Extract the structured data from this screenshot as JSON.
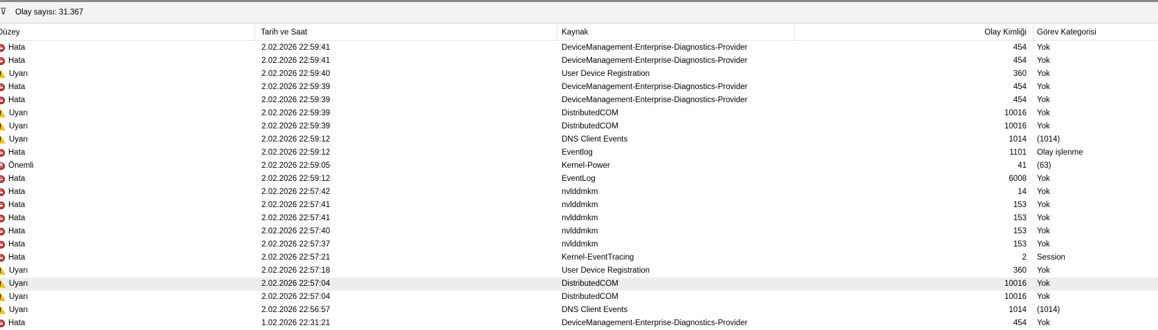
{
  "toolbar": {
    "filter_glyph": "⊽",
    "event_count": "Olay sayısı: 31.367"
  },
  "columns": {
    "level": "Düzey",
    "date": "Tarih ve Saat",
    "source": "Kaynak",
    "event_id": "Olay Kimliği",
    "task_category": "Görev Kategorisi"
  },
  "icons": {
    "error": "error-icon",
    "warning": "warning-icon",
    "critical": "critical-icon"
  },
  "colors": {
    "selected_row": "#ededed",
    "error_red": "#c01515",
    "warning_yellow": "#f3c400"
  },
  "rows": [
    {
      "level": "Hata",
      "icon": "error",
      "date": "2.02.2026 22:59:41",
      "source": "DeviceManagement-Enterprise-Diagnostics-Provider",
      "id": "454",
      "category": "Yok"
    },
    {
      "level": "Hata",
      "icon": "error",
      "date": "2.02.2026 22:59:41",
      "source": "DeviceManagement-Enterprise-Diagnostics-Provider",
      "id": "454",
      "category": "Yok"
    },
    {
      "level": "Uyarı",
      "icon": "warning",
      "date": "2.02.2026 22:59:40",
      "source": "User Device Registration",
      "id": "360",
      "category": "Yok"
    },
    {
      "level": "Hata",
      "icon": "error",
      "date": "2.02.2026 22:59:39",
      "source": "DeviceManagement-Enterprise-Diagnostics-Provider",
      "id": "454",
      "category": "Yok"
    },
    {
      "level": "Hata",
      "icon": "error",
      "date": "2.02.2026 22:59:39",
      "source": "DeviceManagement-Enterprise-Diagnostics-Provider",
      "id": "454",
      "category": "Yok"
    },
    {
      "level": "Uyarı",
      "icon": "warning",
      "date": "2.02.2026 22:59:39",
      "source": "DistributedCOM",
      "id": "10016",
      "category": "Yok"
    },
    {
      "level": "Uyarı",
      "icon": "warning",
      "date": "2.02.2026 22:59:39",
      "source": "DistributedCOM",
      "id": "10016",
      "category": "Yok"
    },
    {
      "level": "Uyarı",
      "icon": "warning",
      "date": "2.02.2026 22:59:12",
      "source": "DNS Client Events",
      "id": "1014",
      "category": "(1014)"
    },
    {
      "level": "Hata",
      "icon": "error",
      "date": "2.02.2026 22:59:12",
      "source": "Eventlog",
      "id": "1101",
      "category": "Olay işlenme"
    },
    {
      "level": "Önemli",
      "icon": "critical",
      "date": "2.02.2026 22:59:05",
      "source": "Kernel-Power",
      "id": "41",
      "category": "(63)"
    },
    {
      "level": "Hata",
      "icon": "error",
      "date": "2.02.2026 22:59:12",
      "source": "EventLog",
      "id": "6008",
      "category": "Yok"
    },
    {
      "level": "Hata",
      "icon": "error",
      "date": "2.02.2026 22:57:42",
      "source": "nvlddmkm",
      "id": "14",
      "category": "Yok"
    },
    {
      "level": "Hata",
      "icon": "error",
      "date": "2.02.2026 22:57:41",
      "source": "nvlddmkm",
      "id": "153",
      "category": "Yok"
    },
    {
      "level": "Hata",
      "icon": "error",
      "date": "2.02.2026 22:57:41",
      "source": "nvlddmkm",
      "id": "153",
      "category": "Yok"
    },
    {
      "level": "Hata",
      "icon": "error",
      "date": "2.02.2026 22:57:40",
      "source": "nvlddmkm",
      "id": "153",
      "category": "Yok"
    },
    {
      "level": "Hata",
      "icon": "error",
      "date": "2.02.2026 22:57:37",
      "source": "nvlddmkm",
      "id": "153",
      "category": "Yok"
    },
    {
      "level": "Hata",
      "icon": "error",
      "date": "2.02.2026 22:57:21",
      "source": "Kernel-EventTracing",
      "id": "2",
      "category": "Session"
    },
    {
      "level": "Uyarı",
      "icon": "warning",
      "date": "2.02.2026 22:57:18",
      "source": "User Device Registration",
      "id": "360",
      "category": "Yok"
    },
    {
      "level": "Uyarı",
      "icon": "warning",
      "date": "2.02.2026 22:57:04",
      "source": "DistributedCOM",
      "id": "10016",
      "category": "Yok",
      "selected": true
    },
    {
      "level": "Uyarı",
      "icon": "warning",
      "date": "2.02.2026 22:57:04",
      "source": "DistributedCOM",
      "id": "10016",
      "category": "Yok"
    },
    {
      "level": "Uyarı",
      "icon": "warning",
      "date": "2.02.2026 22:56:57",
      "source": "DNS Client Events",
      "id": "1014",
      "category": "(1014)"
    },
    {
      "level": "Hata",
      "icon": "error",
      "date": "1.02.2026 22:31:21",
      "source": "DeviceManagement-Enterprise-Diagnostics-Provider",
      "id": "454",
      "category": "Yok"
    }
  ]
}
